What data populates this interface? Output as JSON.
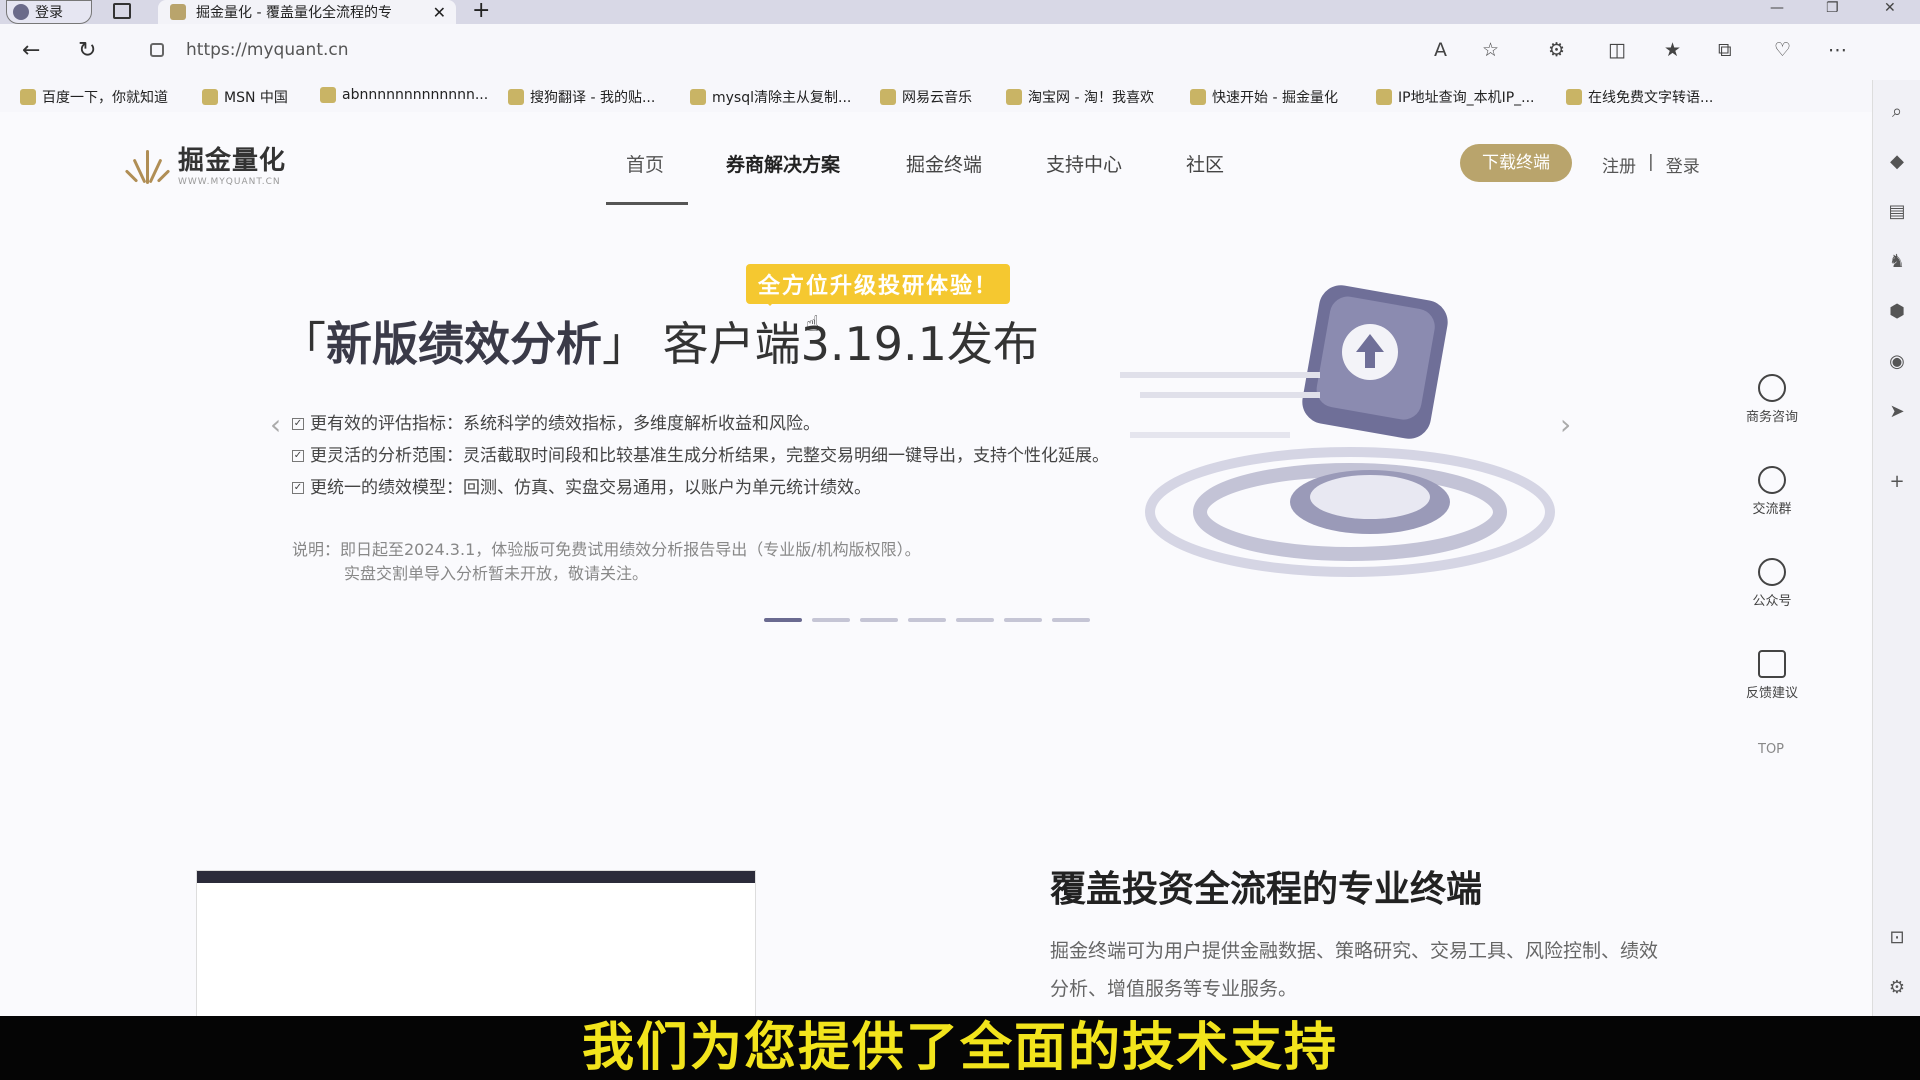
{
  "browser": {
    "profile_label": "登录",
    "tab_title": "掘金量化 - 覆盖量化全流程的专",
    "tab_close": "✕",
    "new_tab": "+",
    "url": "https://myquant.cn",
    "bookmarks": [
      "百度一下，你就知道",
      "MSN 中国",
      "abnnnnnnnnnnnnn...",
      "搜狗翻译 - 我的贴...",
      "mysql清除主从复制...",
      "网易云音乐",
      "淘宝网 - 淘！我喜欢",
      "快速开始 - 掘金量化",
      "IP地址查询_本机IP_...",
      "在线免费文字转语..."
    ]
  },
  "site": {
    "logo_cn": "掘金量化",
    "logo_en": "WWW.MYQUANT.CN",
    "nav": [
      "首页",
      "券商解决方案",
      "掘金终端",
      "支持中心",
      "社区"
    ],
    "download_button": "下载终端",
    "register": "注册",
    "separator": "|",
    "login": "登录"
  },
  "banner": {
    "tag": "全方位升级投研体验！",
    "headline_bracket_open": "「",
    "headline_bold": "新版绩效分析",
    "headline_bracket_close": "」",
    "headline_rest": "客户端3.19.1发布",
    "bullets": [
      "更有效的评估指标：系统科学的绩效指标，多维度解析收益和风险。",
      "更灵活的分析范围：灵活截取时间段和比较基准生成分析结果，完整交易明细一键导出，支持个性化延展。",
      "更统一的绩效模型：回测、仿真、实盘交易通用，以账户为单元统计绩效。"
    ],
    "note_line1": "说明：即日起至2024.3.1，体验版可免费试用绩效分析报告导出（专业版/机构版权限）。",
    "note_line2": "实盘交割单导入分析暂未开放，敬请关注。",
    "slide_count": 7,
    "active_slide": 1
  },
  "float_menu": {
    "items": [
      "商务咨询",
      "交流群",
      "公众号",
      "反馈建议"
    ],
    "top": "TOP"
  },
  "section": {
    "title": "覆盖投资全流程的专业终端",
    "desc": "掘金终端可为用户提供金融数据、策略研究、交易工具、风险控制、绩效分析、增值服务等专业服务。"
  },
  "subtitle": "我们为您提供了全面的技术支持",
  "colors": {
    "accent": "#b9a46c",
    "tag": "#f5c830",
    "caption": "#f2e41c"
  }
}
